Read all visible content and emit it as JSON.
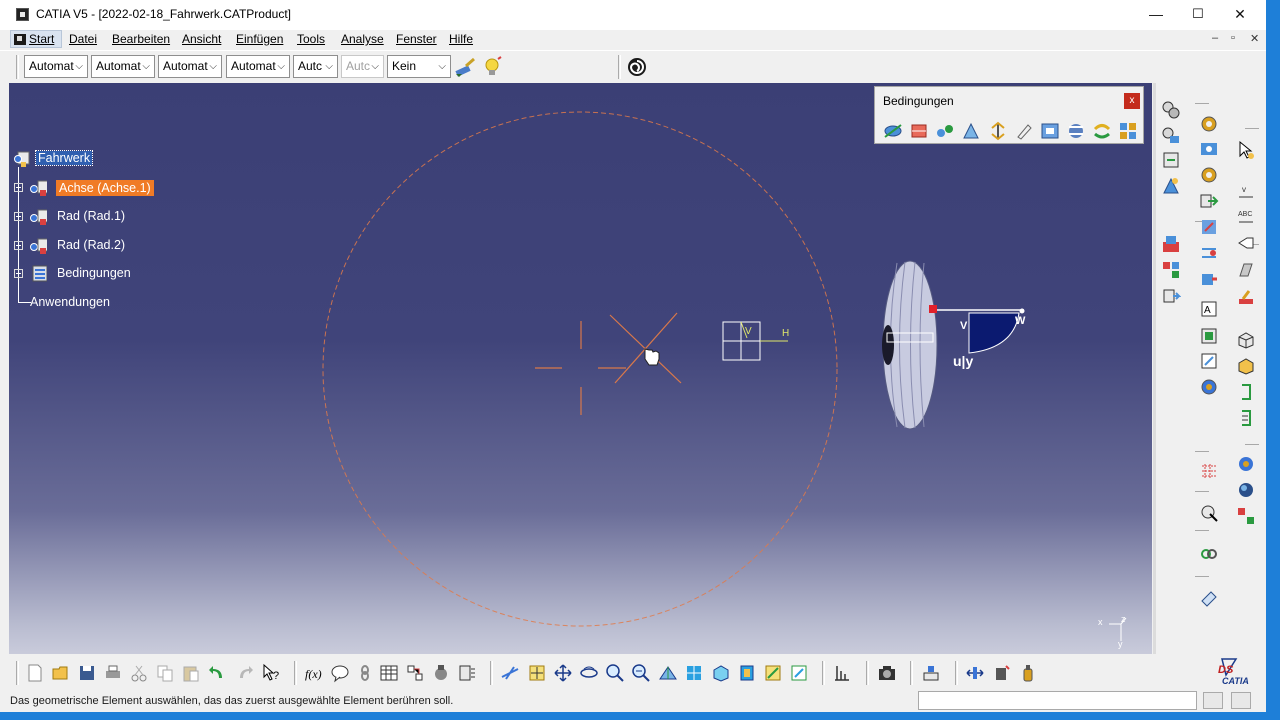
{
  "window": {
    "title": "CATIA V5 - [2022-02-18_Fahrwerk.CATProduct]",
    "minimize": "—",
    "maximize": "☐",
    "close": "✕"
  },
  "menubar": {
    "items": [
      {
        "label": "Start"
      },
      {
        "label": "Datei"
      },
      {
        "label": "Bearbeiten"
      },
      {
        "label": "Ansicht"
      },
      {
        "label": "Einfügen"
      },
      {
        "label": "Tools"
      },
      {
        "label": "Analyse"
      },
      {
        "label": "Fenster"
      },
      {
        "label": "Hilfe"
      }
    ],
    "mdi_minimize": "–",
    "mdi_restore": "▫",
    "mdi_close": "✕"
  },
  "toolbar": {
    "combos": [
      {
        "value": "Automat",
        "enabled": true
      },
      {
        "value": "Automat",
        "enabled": true
      },
      {
        "value": "Automat",
        "enabled": true
      },
      {
        "value": "Automat",
        "enabled": true
      },
      {
        "value": "Autc",
        "enabled": true
      },
      {
        "value": "Autc",
        "enabled": false
      },
      {
        "value": "Kein",
        "enabled": true
      }
    ],
    "icons": [
      "paint-brush-icon",
      "lightbulb-icon",
      "spiral-icon"
    ]
  },
  "tree": {
    "root": "Fahrwerk",
    "items": [
      {
        "label": "Achse (Achse.1)",
        "selected": true
      },
      {
        "label": "Rad (Rad.1)",
        "selected": false
      },
      {
        "label": "Rad (Rad.2)",
        "selected": false
      },
      {
        "label": "Bedingungen",
        "selected": false
      }
    ],
    "applications": "Anwendungen"
  },
  "viewport": {
    "compass_labels": {
      "v": "V",
      "h": "H"
    },
    "wheel_labels": {
      "v": "V",
      "w": "W",
      "uy": "u|y"
    },
    "axis_labels": {
      "x": "x",
      "z": "z",
      "y": "y"
    },
    "colors": {
      "background_top": "#3b3f75",
      "background_bottom": "#c9cbdb",
      "selection": "#f07b26",
      "construction": "#e07a4a"
    }
  },
  "constraints_toolbar": {
    "title": "Bedingungen",
    "close": "x",
    "icons": [
      "coincidence-icon",
      "contact-icon",
      "offset-icon",
      "angle-icon",
      "fix-icon",
      "fix-together-icon",
      "quick-constraint-icon",
      "flexible-rigid-icon",
      "change-constraint-icon",
      "reuse-pattern-icon"
    ]
  },
  "bottom_toolbar": {
    "icons": [
      "new-icon",
      "open-icon",
      "save-icon",
      "print-icon",
      "cut-icon",
      "copy-icon",
      "paste-icon",
      "undo-icon",
      "redo-icon",
      "whats-this-icon",
      "formula-icon",
      "comment-icon",
      "link-icon",
      "table-icon",
      "catalog-icon",
      "knowledge-icon",
      "tools-icon",
      "fly-mode-icon",
      "fit-all-icon",
      "pan-icon",
      "rotate-icon",
      "zoom-in-icon",
      "zoom-out-icon",
      "normal-view-icon",
      "multi-view-icon",
      "iso-view-icon",
      "render-style-icon",
      "hide-show-icon",
      "swap-visible-icon",
      "measure-icon",
      "camera-icon",
      "snap-icon",
      "manipulate-icon",
      "explode-icon",
      "sensor-icon"
    ],
    "brand": "CATIA"
  },
  "statusbar": {
    "message": "Das geometrische Element auswählen, das das zuerst ausgewählte Element berühren soll.",
    "input_value": ""
  }
}
